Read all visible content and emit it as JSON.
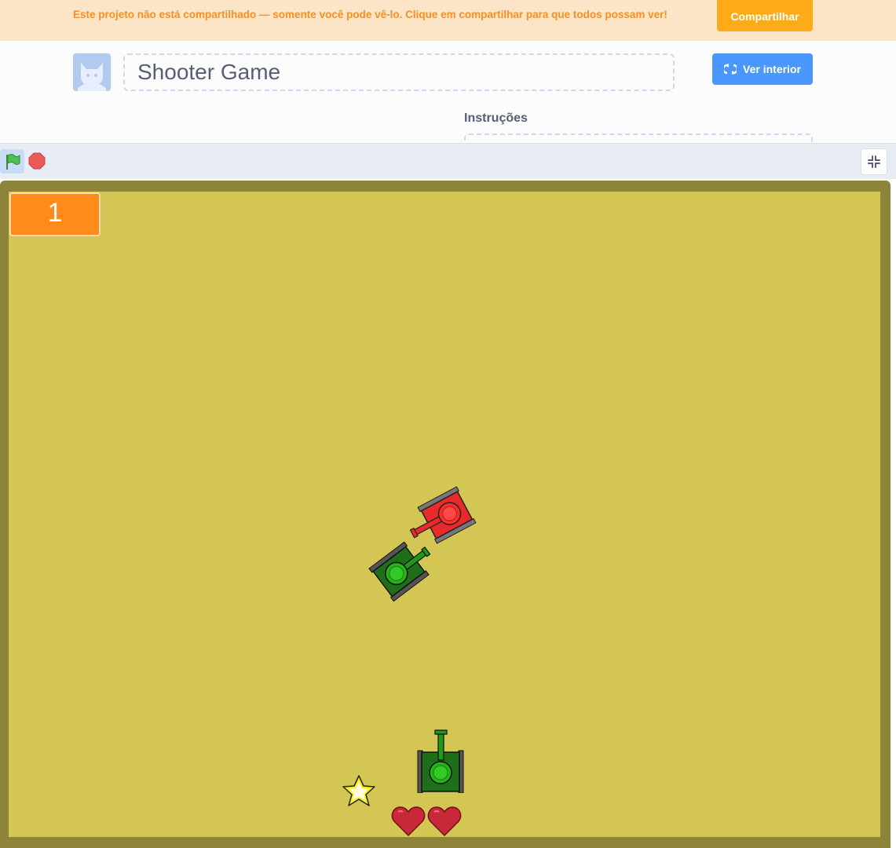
{
  "banner": {
    "message": "Este projeto não está compartilhado — somente você pode vê-lo. Clique em compartilhar para que todos possam ver!",
    "share_label": "Compartilhar"
  },
  "header": {
    "project_title": "Shooter Game",
    "see_inside_label": "Ver interior",
    "instructions_label": "Instruções"
  },
  "controls": {
    "green_flag_icon": "green-flag-icon",
    "stop_icon": "stop-sign-icon",
    "fullscreen_icon": "exit-fullscreen-icon"
  },
  "stage": {
    "score_value": "1",
    "colors": {
      "frame": "#8d843a",
      "background": "#d4c655",
      "score_monitor": "#ff8c1a"
    },
    "sprites": [
      {
        "name": "red-enemy-tank",
        "color": "#e82a2a"
      },
      {
        "name": "green-enemy-tank",
        "color": "#1f6e1a"
      },
      {
        "name": "player-tank",
        "color": "#1f6e1a"
      },
      {
        "name": "star-powerup",
        "color": "#ffee22"
      },
      {
        "name": "lives-hearts",
        "count": 2,
        "color": "#c9283a"
      }
    ]
  }
}
